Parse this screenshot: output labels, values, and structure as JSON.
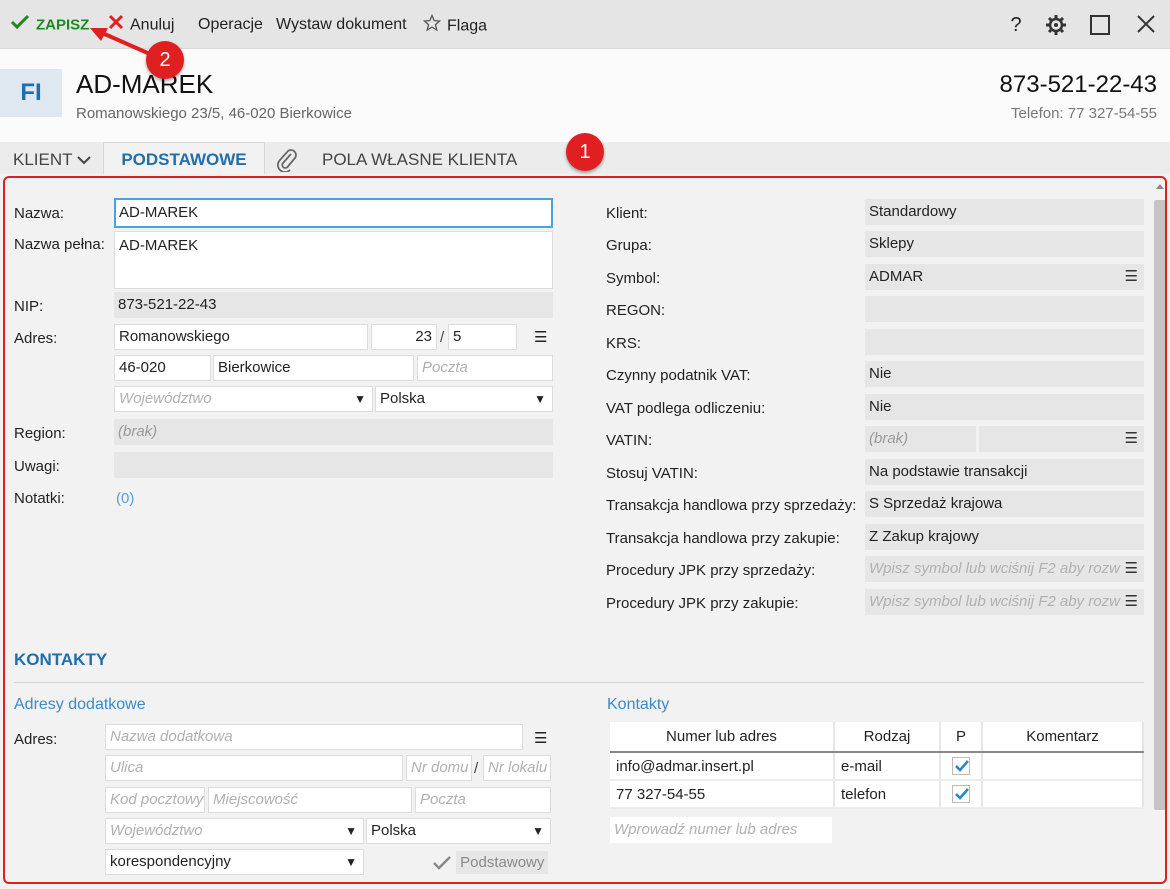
{
  "toolbar": {
    "save_label": "ZAPISZ",
    "cancel_label": "Anuluj",
    "operations_label": "Operacje",
    "issue_doc_label": "Wystaw dokument",
    "flag_label": "Flaga",
    "help_label": "?",
    "accent_save": "#1e8a1e",
    "accent_cancel": "#e02020"
  },
  "header": {
    "initials": "FI",
    "name": "AD-MAREK",
    "address": "Romanowskiego 23/5, 46-020 Bierkowice",
    "nip": "873-521-22-43",
    "phone": "Telefon: 77 327-54-55"
  },
  "tabs": {
    "client": "KLIENT",
    "basic": "PODSTAWOWE",
    "custom_fields": "POLA WŁASNE KLIENTA"
  },
  "left": {
    "name_label": "Nazwa:",
    "name_value": "AD-MAREK",
    "full_name_label": "Nazwa pełna:",
    "full_name_value": "AD-MAREK",
    "nip_label": "NIP:",
    "nip_value": "873-521-22-43",
    "address_label": "Adres:",
    "street": "Romanowskiego",
    "house_no": "23",
    "slash": "/",
    "flat_no": "5",
    "postal_code": "46-020",
    "city": "Bierkowice",
    "post_placeholder": "Poczta",
    "province_placeholder": "Województwo",
    "country": "Polska",
    "region_label": "Region:",
    "region_value": "(brak)",
    "remarks_label": "Uwagi:",
    "notes_label": "Notatki:",
    "notes_value": "(0)"
  },
  "right": {
    "client_label": "Klient:",
    "client_value": "Standardowy",
    "group_label": "Grupa:",
    "group_value": "Sklepy",
    "symbol_label": "Symbol:",
    "symbol_value": "ADMAR",
    "regon_label": "REGON:",
    "krs_label": "KRS:",
    "vat_active_label": "Czynny podatnik VAT:",
    "vat_active_value": "Nie",
    "vat_deductible_label": "VAT podlega odliczeniu:",
    "vat_deductible_value": "Nie",
    "vatin_label": "VATIN:",
    "vatin_value": "(brak)",
    "use_vatin_label": "Stosuj VATIN:",
    "use_vatin_value": "Na podstawie transakcji",
    "sale_tx_label": "Transakcja handlowa przy sprzedaży:",
    "sale_tx_value": "S  Sprzedaż krajowa",
    "purchase_tx_label": "Transakcja handlowa przy zakupie:",
    "purchase_tx_value": "Z  Zakup krajowy",
    "jpk_sale_label": "Procedury JPK przy sprzedaży:",
    "jpk_sale_placeholder": "Wpisz symbol lub wciśnij F2 aby rozw",
    "jpk_purchase_label": "Procedury JPK przy zakupie:",
    "jpk_purchase_placeholder": "Wpisz symbol lub wciśnij F2 aby rozw"
  },
  "contacts_section": {
    "title": "KONTAKTY",
    "extra_addresses_title": "Adresy dodatkowe",
    "address_label": "Adres:",
    "extra_name_placeholder": "Nazwa dodatkowa",
    "street_placeholder": "Ulica",
    "house_placeholder": "Nr domu",
    "slash": "/",
    "flat_placeholder": "Nr lokalu",
    "postal_placeholder": "Kod pocztowy",
    "city_placeholder": "Miejscowość",
    "post_placeholder": "Poczta",
    "province_placeholder": "Województwo",
    "country": "Polska",
    "address_type": "korespondencyjny",
    "default_label": "Podstawowy",
    "contacts_title": "Kontakty",
    "table_headers": [
      "Numer lub adres",
      "Rodzaj",
      "P",
      "Komentarz"
    ],
    "rows": [
      {
        "value": "info@admar.insert.pl",
        "type": "e-mail",
        "primary": true,
        "comment": ""
      },
      {
        "value": "77 327-54-55",
        "type": "telefon",
        "primary": true,
        "comment": ""
      }
    ],
    "new_contact_placeholder": "Wprowadź numer lub adres"
  },
  "annotations": {
    "badge1": "1",
    "badge2": "2",
    "color": "#e02020"
  }
}
